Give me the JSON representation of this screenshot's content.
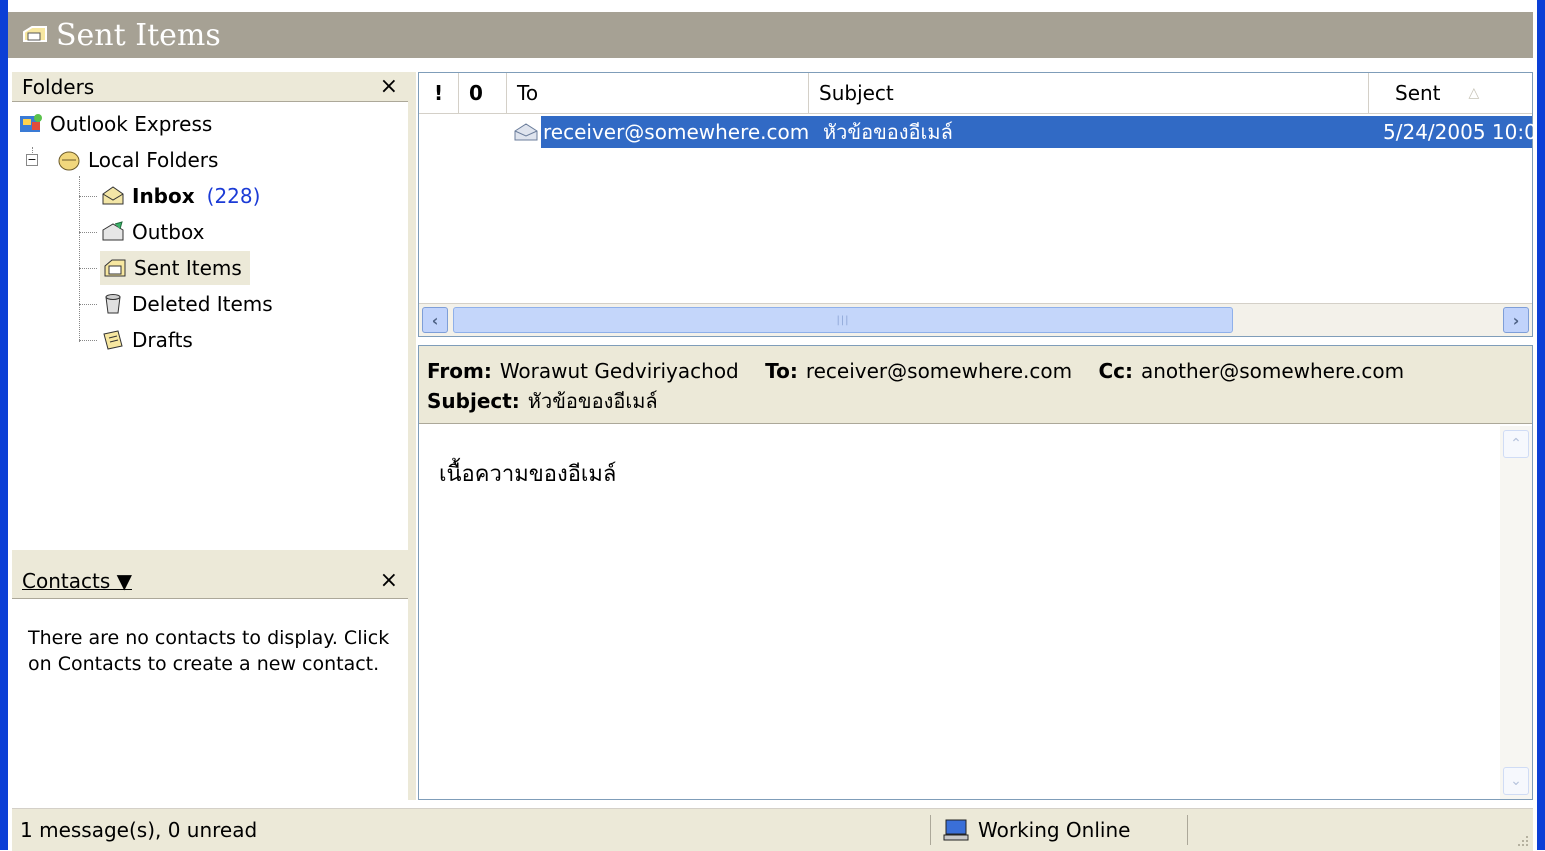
{
  "window": {
    "title": "Sent Items"
  },
  "folders_pane": {
    "title": "Folders",
    "close": "×",
    "tree": {
      "root": "Outlook Express",
      "local": "Local Folders",
      "inbox": "Inbox",
      "inbox_count": "(228)",
      "outbox": "Outbox",
      "sent": "Sent Items",
      "deleted": "Deleted Items",
      "drafts": "Drafts"
    }
  },
  "contacts_pane": {
    "title": "Contacts ▼",
    "close": "×",
    "message": "There are no contacts to display. Click on Contacts to create a new contact."
  },
  "message_list": {
    "columns": {
      "priority": "!",
      "attachment": "0",
      "to": "To",
      "subject": "Subject",
      "sent": "Sent"
    },
    "rows": [
      {
        "to": "receiver@somewhere.com",
        "subject": "หัวข้อของอีเมล์",
        "sent": "5/24/2005 10:0",
        "selected": true
      }
    ]
  },
  "preview": {
    "from_label": "From:",
    "from": "Worawut Gedviriyachod",
    "to_label": "To:",
    "to": "receiver@somewhere.com",
    "cc_label": "Cc:",
    "cc": "another@somewhere.com",
    "subject_label": "Subject:",
    "subject": "หัวข้อของอีเมล์",
    "body": "เนื้อความของอีเมล์"
  },
  "status": {
    "messages": "1 message(s), 0 unread",
    "connection": "Working Online"
  },
  "colors": {
    "selection": "#316ac5",
    "frame": "#0b3fd6",
    "title_bar": "#a6a194",
    "panel": "#ece9d8"
  }
}
